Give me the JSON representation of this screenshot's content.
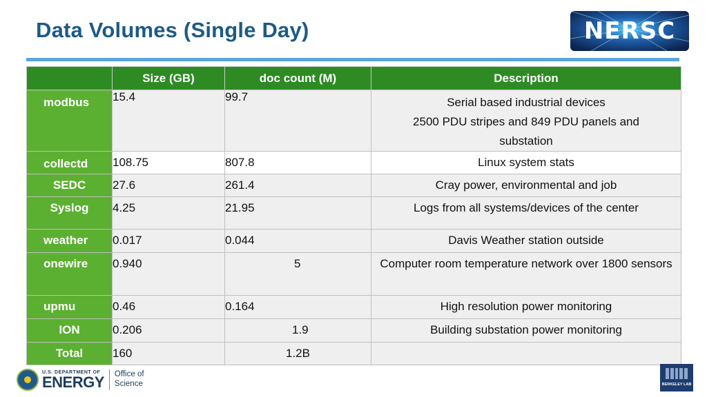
{
  "slide": {
    "title": "Data Volumes (Single Day)"
  },
  "logo": {
    "text": "NERSC"
  },
  "table": {
    "headers": [
      "",
      "Size (GB)",
      "doc count (M)",
      "Description"
    ],
    "rows": [
      {
        "name": "modbus",
        "size": "15.4",
        "count": "99.7",
        "desc_lines": [
          "Serial based industrial devices",
          "2500 PDU stripes and 849 PDU panels and substation"
        ]
      },
      {
        "name": "collectd",
        "size": "108.75",
        "count": "807.8",
        "desc_lines": [
          "Linux system stats"
        ]
      },
      {
        "name": "SEDC",
        "size": "27.6",
        "count": "261.4",
        "desc_lines": [
          "Cray power, environmental and job"
        ]
      },
      {
        "name": "Syslog",
        "size": "4.25",
        "count": "21.95",
        "desc_lines": [
          "Logs from all systems/devices of the center"
        ]
      },
      {
        "name": "weather",
        "size": "0.017",
        "count": "0.044",
        "desc_lines": [
          "Davis Weather station outside"
        ]
      },
      {
        "name": "onewire",
        "size": "0.940",
        "count": "5",
        "desc_lines": [
          "Computer room temperature network over 1800 sensors"
        ]
      },
      {
        "name": "upmu",
        "size": "0.46",
        "count": "0.164",
        "desc_lines": [
          "High resolution power monitoring"
        ]
      },
      {
        "name": "ION",
        "size": "0.206",
        "count": "1.9",
        "desc_lines": [
          "Building substation power monitoring"
        ]
      },
      {
        "name": "Total",
        "size": "160",
        "count": "1.2B",
        "desc_lines": []
      }
    ]
  },
  "footer": {
    "doe_small": "U.S. DEPARTMENT OF",
    "doe_big": "ENERGY",
    "office_line1": "Office of",
    "office_line2": "Science",
    "berkeley": "BERKELEY LAB"
  },
  "colors": {
    "header_green": "#2e8b24",
    "row_green": "#5cb031",
    "title_blue": "#1d5a86",
    "rule_blue": "#5aa5dc"
  }
}
